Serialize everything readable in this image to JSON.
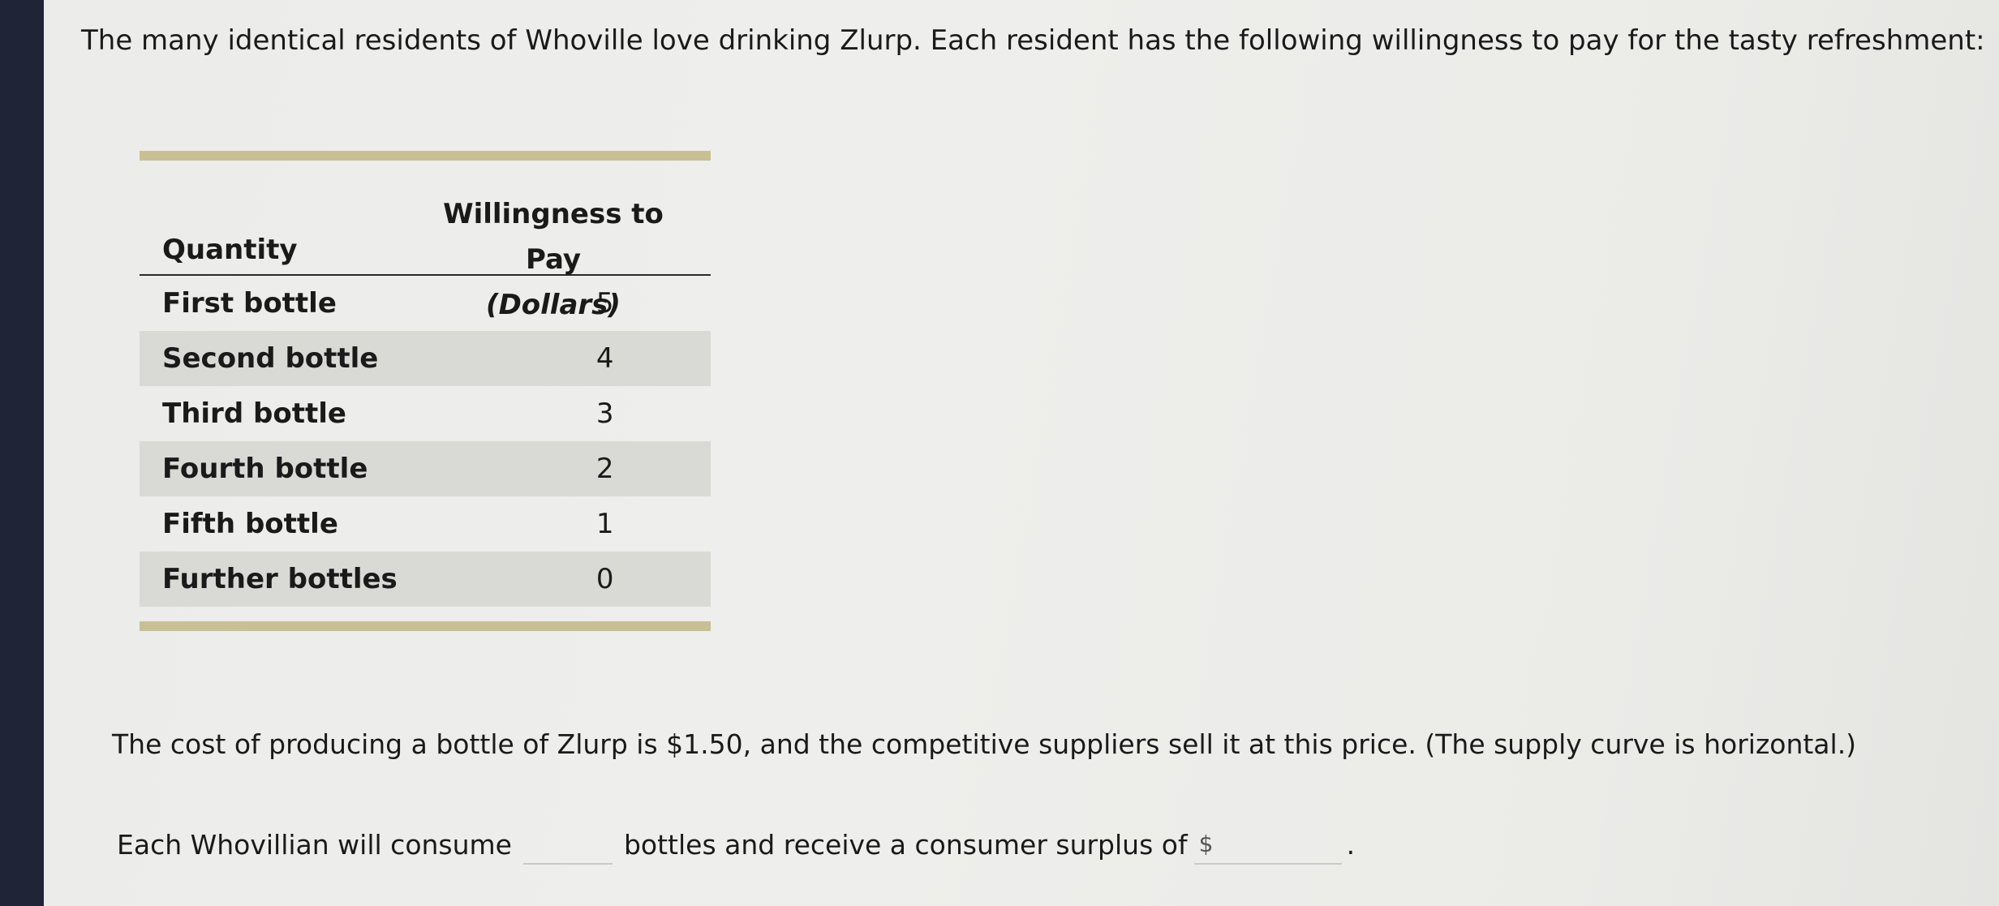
{
  "intro": "The many identical residents of Whoville love drinking Zlurp. Each resident has the following willingness to pay for the tasty refreshment:",
  "table": {
    "header_quantity": "Quantity",
    "header_wtp": "Willingness to Pay",
    "header_unit": "(Dollars)",
    "rows": [
      {
        "label": "First bottle",
        "value": "5"
      },
      {
        "label": "Second bottle",
        "value": "4"
      },
      {
        "label": "Third bottle",
        "value": "3"
      },
      {
        "label": "Fourth bottle",
        "value": "2"
      },
      {
        "label": "Fifth bottle",
        "value": "1"
      },
      {
        "label": "Further bottles",
        "value": "0"
      }
    ]
  },
  "cost_text": "The cost of producing a bottle of Zlurp is $1.50, and the competitive suppliers sell it at this price. (The supply curve is horizontal.)",
  "answer": {
    "part1": "Each Whovillian will consume",
    "part2": "bottles and receive a consumer surplus of",
    "currency": "$",
    "quantity_value": "",
    "surplus_value": "",
    "end": "."
  }
}
